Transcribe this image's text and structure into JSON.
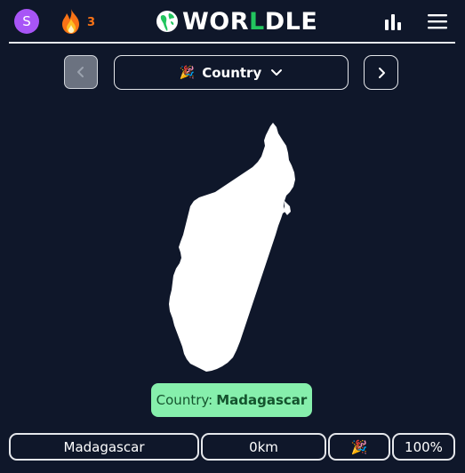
{
  "header": {
    "avatar_letter": "S",
    "streak_count": "3",
    "logo": {
      "prefix": "WOR",
      "accent": "L",
      "suffix": "DLE"
    }
  },
  "nav": {
    "select_emoji": "🎉",
    "select_label": "Country"
  },
  "answer": {
    "label": "Country:",
    "value": "Madagascar"
  },
  "guess": {
    "name": "Madagascar",
    "distance": "0km",
    "direction": "🎉",
    "proximity": "100%"
  },
  "colors": {
    "background": "#0f172a",
    "avatar": "#a855f7",
    "streak": "#f97316",
    "logo_accent": "#22c55e",
    "answer_bg": "#86efac",
    "answer_text": "#14532d"
  },
  "icons": {
    "streak": "flame-icon",
    "stats": "bar-chart-icon",
    "menu": "hamburger-menu-icon",
    "prev": "chevron-left-icon",
    "next": "chevron-right-icon",
    "select": "chevron-down-icon"
  }
}
